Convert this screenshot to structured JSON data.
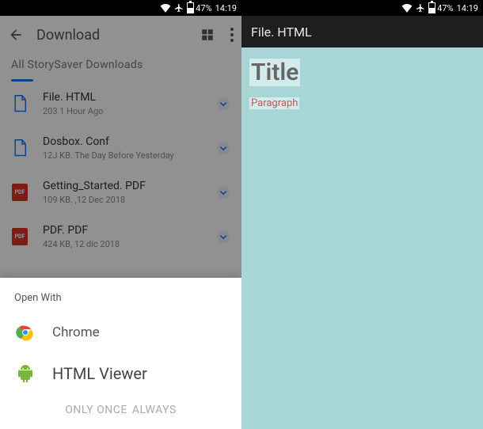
{
  "status": {
    "battery_pct": "47%",
    "time": "14:19"
  },
  "left": {
    "header_title": "Download",
    "breadcrumb": "All StorySaver Downloads",
    "files": [
      {
        "name": "File. HTML",
        "meta": "203 1 Hour Ago",
        "type": "doc"
      },
      {
        "name": "Dosbox. Conf",
        "meta": "12J KB. The Day Before Yesterday",
        "type": "doc"
      },
      {
        "name": "Getting_Started. PDF",
        "meta": "109 KB. ,12 Dec 2018",
        "type": "pdf"
      },
      {
        "name": "PDF. PDF",
        "meta": "424 KB, 12 dic 2018",
        "type": "pdf"
      }
    ],
    "sheet": {
      "title": "Open With",
      "options": [
        {
          "label": "Chrome"
        },
        {
          "label": "HTML Viewer"
        }
      ],
      "action_once": "ONLY ONCE",
      "action_always": "ALWAYS"
    }
  },
  "right": {
    "header_title": "File. HTML",
    "page_title": "Title",
    "page_paragraph": "Paragraph"
  },
  "icons": {
    "pdf_label": "PDF"
  }
}
